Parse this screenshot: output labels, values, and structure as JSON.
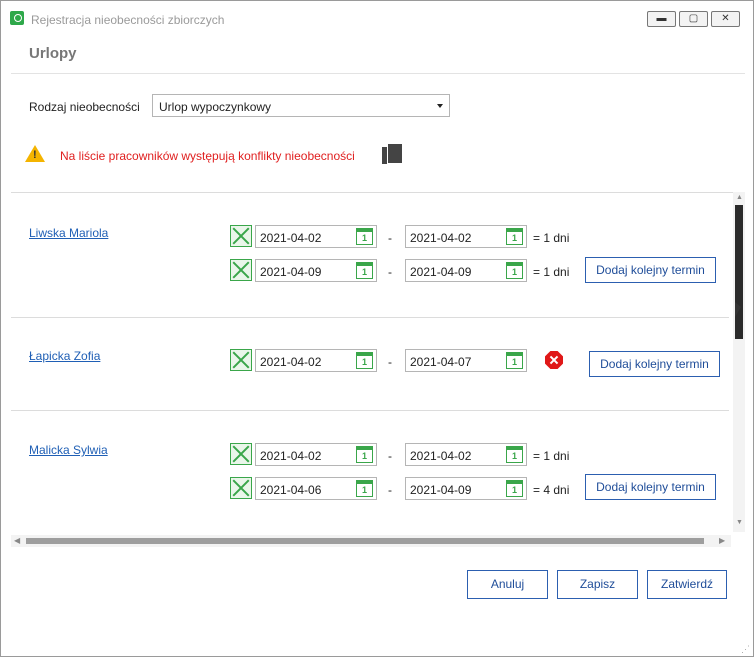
{
  "window": {
    "title": "Rejestracja nieobecności zbiorczych",
    "controls": {
      "minimize": "▬",
      "maximize": "▢",
      "close": "✕"
    }
  },
  "header": {
    "section_title": "Urlopy"
  },
  "form": {
    "absence_type_label": "Rodzaj nieobecności",
    "absence_type_value": "Urlop wypoczynkowy"
  },
  "warning": {
    "text": "Na liście pracowników występują konflikty nieobecności"
  },
  "employees": [
    {
      "name": "Liwska Mariola",
      "periods": [
        {
          "from": "2021-04-02",
          "to": "2021-04-02",
          "days": "= 1 dni"
        },
        {
          "from": "2021-04-09",
          "to": "2021-04-09",
          "days": "= 1 dni"
        }
      ]
    },
    {
      "name": "Łapicka Zofia",
      "periods": [
        {
          "from": "2021-04-02",
          "to": "2021-04-07",
          "days": ""
        }
      ]
    },
    {
      "name": "Malicka Sylwia",
      "periods": [
        {
          "from": "2021-04-02",
          "to": "2021-04-02",
          "days": "= 1 dni"
        },
        {
          "from": "2021-04-06",
          "to": "2021-04-09",
          "days": "= 4 dni"
        }
      ]
    }
  ],
  "common": {
    "dash": "-",
    "calendar_day": "1",
    "add_term_label": "Dodaj kolejny termin"
  },
  "footer": {
    "cancel": "Anuluj",
    "save": "Zapisz",
    "confirm": "Zatwierdź"
  },
  "colors": {
    "link": "#1f5fb5",
    "warning_text": "#e02020",
    "accent_green": "#3aa64a",
    "button_border": "#2c5fb0",
    "error": "#e01818"
  }
}
